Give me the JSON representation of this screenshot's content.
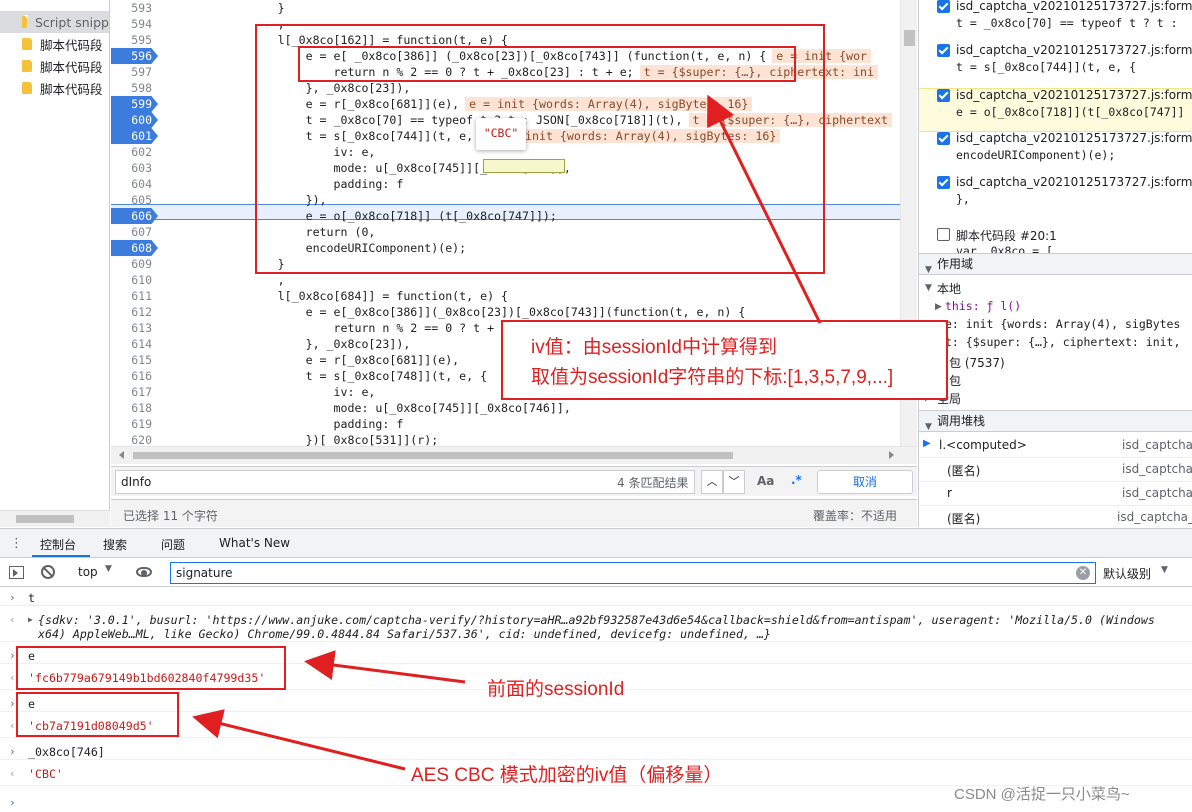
{
  "left_nav": {
    "items": [
      "Script snipp",
      "脚本代码段",
      "脚本代码段",
      "脚本代码段"
    ]
  },
  "code": {
    "lines": [
      {
        "n": "593",
        "t": "                }"
      },
      {
        "n": "594",
        "t": "                ,"
      },
      {
        "n": "595",
        "t": "                l[_0x8co[162]] = function(t, e) {"
      },
      {
        "n": "596",
        "t": "                    e = e[ _0x8co[386]] (_0x8co[23])[_0x8co[743]] (function(t, e, n) {",
        "ann": "e = init {wor"
      },
      {
        "n": "597",
        "t": "                        return n % 2 == 0 ? t + _0x8co[23] : t + e;",
        "ann": "t = {$super: {…}, ciphertext: ini"
      },
      {
        "n": "598",
        "t": "                    }, _0x8co[23]),"
      },
      {
        "n": "599",
        "t": "                    e = r[_0x8co[681]](e),",
        "ann": "e = init {words: Array(4), sigBytes: 16}"
      },
      {
        "n": "600",
        "t": "                    t = _0x8co[70] == typeof t ? t : JSON[_0x8co[718]](t),",
        "ann": "t = {$super: {…}, ciphertext"
      },
      {
        "n": "601",
        "t": "                    t = s[_0x8co[744]](t, e, {",
        "ann": "e = init {words: Array(4), sigBytes: 16}"
      },
      {
        "n": "602",
        "t": "                        iv: e,"
      },
      {
        "n": "603",
        "t": "                        mode: u[_0x8co[745]][_0x8co[746]],"
      },
      {
        "n": "604",
        "t": "                        padding: f"
      },
      {
        "n": "605",
        "t": "                    }),"
      },
      {
        "n": "606",
        "t": "                    e = o[_0x8co[718]] (t[_0x8co[747]]);"
      },
      {
        "n": "607",
        "t": "                    return (0,"
      },
      {
        "n": "608",
        "t": "                    encodeURIComponent)(e);"
      },
      {
        "n": "609",
        "t": "                }"
      },
      {
        "n": "610",
        "t": "                ,"
      },
      {
        "n": "611",
        "t": "                l[_0x8co[684]] = function(t, e) {"
      },
      {
        "n": "612",
        "t": "                    e = e[_0x8co[386]](_0x8co[23])[_0x8co[743]](function(t, e, n) {"
      },
      {
        "n": "613",
        "t": "                        return n % 2 == 0 ? t + _0x8co[23] : t + e;"
      },
      {
        "n": "614",
        "t": "                    }, _0x8co[23]),"
      },
      {
        "n": "615",
        "t": "                    e = r[_0x8co[681]](e),"
      },
      {
        "n": "616",
        "t": "                    t = s[_0x8co[748]](t, e, {"
      },
      {
        "n": "617",
        "t": "                        iv: e,"
      },
      {
        "n": "618",
        "t": "                        mode: u[_0x8co[745]][_0x8co[746]],"
      },
      {
        "n": "619",
        "t": "                        padding: f"
      },
      {
        "n": "620",
        "t": "                    })[_0x8co[531]](r);"
      }
    ],
    "breakpoint_lines": [
      "596",
      "599",
      "600",
      "601",
      "606",
      "608"
    ],
    "hover_tooltip": "\"CBC\""
  },
  "search": {
    "value": "dInfo",
    "matches": "4 条匹配结果",
    "aa": "Aa",
    "regex": ".*",
    "cancel": "取消"
  },
  "status": {
    "selected": "已选择 11 个字符",
    "coverage": "覆盖率：不适用"
  },
  "breakpoints": [
    {
      "file": "isd_captcha_v20210125173727.js:formatte",
      "code": "t = _0x8co[70] == typeof t ? t :",
      "checked": true
    },
    {
      "file": "isd_captcha_v20210125173727.js:formatte",
      "code": "t = s[_0x8co[744]](t, e, {",
      "checked": true
    },
    {
      "file": "isd_captcha_v20210125173727.js:formatte",
      "code": "e = o[_0x8co[718]](t[_0x8co[747]]",
      "checked": true
    },
    {
      "file": "isd_captcha_v20210125173727.js:formatte",
      "code": "encodeURIComponent)(e);",
      "checked": true
    },
    {
      "file": "isd_captcha_v20210125173727.js:formatte",
      "code": "},",
      "checked": true
    },
    {
      "file": "脚本代码段 #20:1",
      "code": "var _0x8co = [",
      "checked": false
    }
  ],
  "scope": {
    "title": "作用域",
    "local": "本地",
    "this_line": "this: ƒ l()",
    "e_line": "e: init {words: Array(4), sigBytes",
    "t_line": "t: {$super: {…}, ciphertext: init,",
    "closure1": "闭包 (7537)",
    "closure2": "闭包",
    "global": "全局"
  },
  "callstack": {
    "title": "调用堆栈",
    "frames": [
      {
        "name": "l.<computed>",
        "file": "isd_captcha_"
      },
      {
        "name": "(匿名)",
        "file": "isd_captcha_"
      },
      {
        "name": "r",
        "file": "isd_captcha_"
      },
      {
        "name": "(匿名)",
        "file": "isd_captcha_v"
      }
    ]
  },
  "console_tabs": [
    "控制台",
    "搜索",
    "问题",
    "What's New"
  ],
  "console_toolbar": {
    "context": "top",
    "filter": "signature",
    "level": "默认级别"
  },
  "console": [
    {
      "kind": "in",
      "text": "t"
    },
    {
      "kind": "out",
      "text": "{sdkv: '3.0.1', busurl: 'https://www.anjuke.com/captcha-verify/?history=aHR…a92bf932587e43d6e54&callback=shield&from=antispam', useragent: 'Mozilla/5.0 (Windows",
      "text2": "x64) AppleWeb…ML, like Gecko) Chrome/99.0.4844.84 Safari/537.36', cid: undefined, devicefg: undefined, …}"
    },
    {
      "kind": "in",
      "text": "e"
    },
    {
      "kind": "out",
      "text": "'fc6b779a679149b1bd602840f4799d35'"
    },
    {
      "kind": "in",
      "text": "e"
    },
    {
      "kind": "out",
      "text": "'cb7a7191d08049d5'"
    },
    {
      "kind": "in",
      "text": "_0x8co[746]"
    },
    {
      "kind": "out",
      "text": "'CBC'"
    }
  ],
  "annotations": {
    "iv_note_1": "iv值：由sessionId中计算得到",
    "iv_note_2": "取值为sessionId字符串的下标:[1,3,5,7,9,...]",
    "session_note": "前面的sessionId",
    "aes_note": "AES CBC 模式加密的iv值（偏移量）"
  },
  "watermark": "CSDN @活捉一只小菜鸟~"
}
